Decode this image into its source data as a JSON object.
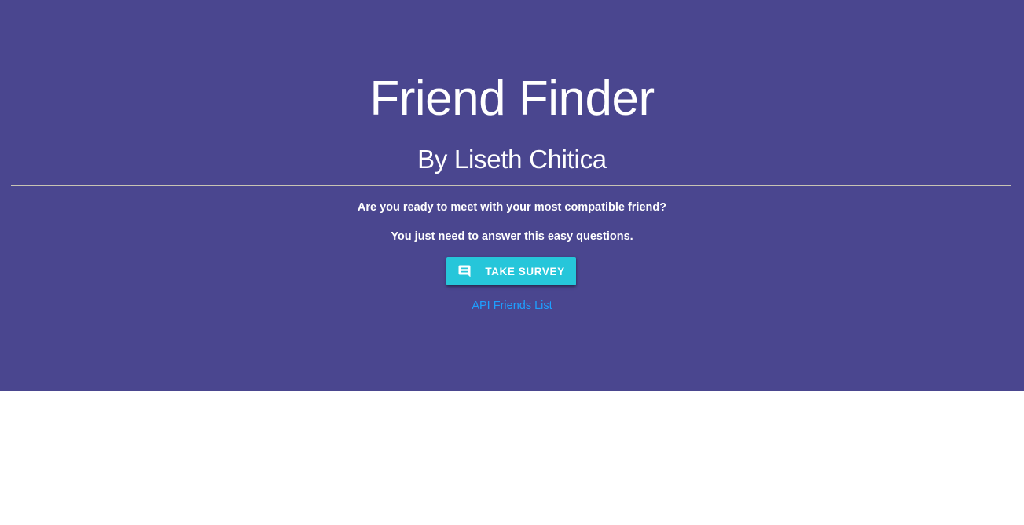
{
  "hero": {
    "title": "Friend Finder",
    "subtitle": "By Liseth Chitica",
    "line1": "Are you ready to meet with your most compatible friend?",
    "line2": "You just need to answer this easy questions.",
    "survey_button": {
      "label": "TAKE SURVEY",
      "icon": "comment-icon"
    },
    "api_link": "API Friends List"
  },
  "colors": {
    "hero_background": "#4a468f",
    "button_background": "#26c6da",
    "link": "#1ea0ff",
    "divider": "#c8c4b4"
  }
}
